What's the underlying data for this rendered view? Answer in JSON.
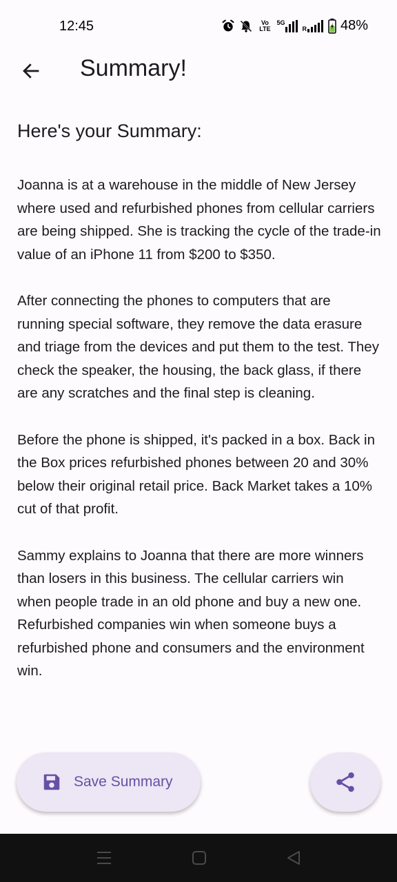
{
  "status_bar": {
    "time": "12:45",
    "network_volte": "Vo LTE",
    "network_5g": "5G",
    "roaming": "R",
    "battery": "48%"
  },
  "app_bar": {
    "title": "Summary!"
  },
  "content": {
    "heading": "Here's your Summary:",
    "paragraphs": [
      "Joanna is at a warehouse in the middle of New Jersey where used and refurbished phones from cellular carriers are being shipped. She is tracking the cycle of the trade-in value of an iPhone 11 from $200 to $350.",
      "After connecting the phones to computers that are running special software, they remove the data erasure and triage from the devices and put them to the test. They check the speaker, the housing, the back glass, if there are any scratches and the final step is cleaning.",
      "Before the phone is shipped, it's packed in a box. Back in the Box prices refurbished phones between 20 and 30% below their original retail price. Back Market takes a 10% cut of that profit.",
      "Sammy explains to Joanna that there are more winners than losers in this business. The cellular carriers win when people trade in an old phone and buy a new one. Refurbished companies win when someone buys a refurbished phone and consumers and the environment win."
    ]
  },
  "actions": {
    "save_label": "Save Summary"
  },
  "colors": {
    "accent": "#6750a4",
    "button_bg": "#ece6f5",
    "background": "#fefbfe",
    "nav_bg": "#111111"
  },
  "icons": {
    "alarm": "alarm-icon",
    "mute": "bell-off-icon",
    "save": "floppy-disk-icon",
    "share": "share-icon",
    "back": "arrow-left-icon"
  }
}
